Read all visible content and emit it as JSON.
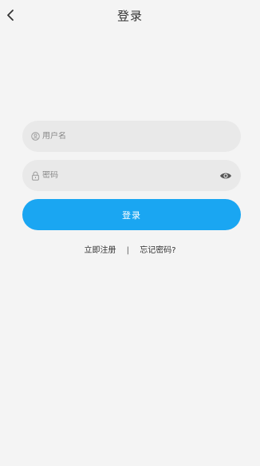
{
  "header": {
    "title": "登录",
    "back_icon": "chevron-left-icon"
  },
  "form": {
    "username": {
      "placeholder": "用户名",
      "value": "",
      "icon": "user-icon"
    },
    "password": {
      "placeholder": "密码",
      "value": "",
      "icon": "lock-icon",
      "toggle_icon": "eye-icon"
    },
    "submit_label": "登录"
  },
  "links": {
    "register": "立即注册",
    "separator": "|",
    "forgot": "忘记密码?"
  },
  "colors": {
    "background": "#f4f4f4",
    "field_background": "#e9e9e9",
    "accent": "#1aa6f2",
    "text": "#333333"
  }
}
